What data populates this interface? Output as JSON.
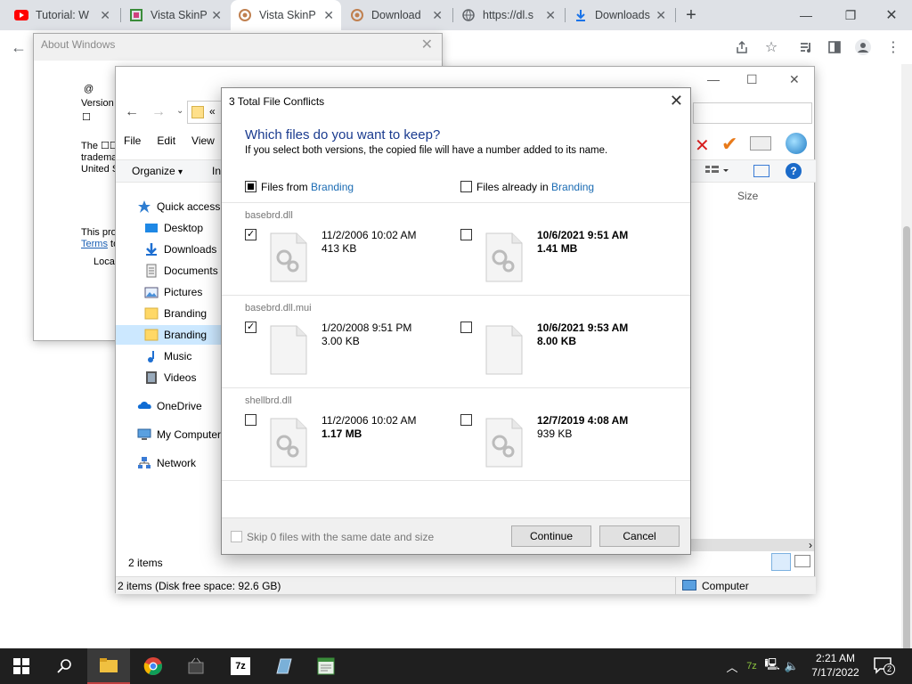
{
  "browser": {
    "tabs": [
      {
        "title": "Tutorial: W",
        "favicon": "youtube-icon"
      },
      {
        "title": "Vista SkinP",
        "favicon": "vistaskin-icon"
      },
      {
        "title": "Vista SkinP",
        "favicon": "vistaskin-icon",
        "active": true
      },
      {
        "title": "Download",
        "favicon": "vistaskin-icon"
      },
      {
        "title": "https://dl.s",
        "favicon": "globe-icon"
      },
      {
        "title": "Downloads",
        "favicon": "download-icon"
      }
    ],
    "new_tab": "+"
  },
  "about_windows": {
    "title": "About Windows",
    "at": "@",
    "version": "Version",
    "box": "☐",
    "line_the": "The ☐☐",
    "line_tradema": "tradema",
    "line_united": "United S",
    "line_this": "This proc",
    "line_terms": "Terms",
    "line_terms_rest": " to",
    "line_local": "Local"
  },
  "explorer": {
    "address_chevron": "«",
    "menu": [
      "File",
      "Edit",
      "View"
    ],
    "organize": "Organize",
    "organize_caret": "▾",
    "in_label": "In",
    "column_size": "Size",
    "nav": [
      {
        "label": "Quick access",
        "icon": "star-icon"
      },
      {
        "label": "Desktop",
        "icon": "desktop-icon"
      },
      {
        "label": "Downloads",
        "icon": "downloads-icon"
      },
      {
        "label": "Documents",
        "icon": "documents-icon"
      },
      {
        "label": "Pictures",
        "icon": "pictures-icon"
      },
      {
        "label": "Branding",
        "icon": "folder-icon"
      },
      {
        "label": "Branding",
        "icon": "folder-icon",
        "selected": true
      },
      {
        "label": "Music",
        "icon": "music-icon"
      },
      {
        "label": "Videos",
        "icon": "videos-icon"
      },
      {
        "label": "OneDrive",
        "icon": "onedrive-icon"
      },
      {
        "label": "My Computer",
        "icon": "computer-icon"
      },
      {
        "label": "Network",
        "icon": "network-icon"
      }
    ],
    "item_count": "2 items",
    "status_left": "2 items (Disk free space: 92.6 GB)",
    "status_right": "Computer"
  },
  "dialog": {
    "title": "3 Total File Conflicts",
    "heading": "Which files do you want to keep?",
    "subtext": "If you select both versions, the copied file will have a number added to its name.",
    "from_prefix": "Files from ",
    "from_folder": "Branding",
    "already_prefix": "Files already in ",
    "already_folder": "Branding",
    "files": [
      {
        "name": "basebrd.dll",
        "left_date": "11/2/2006 10:02 AM",
        "left_size": "413 KB",
        "right_date": "10/6/2021 9:51 AM",
        "right_size": "1.41 MB",
        "left_checked": true,
        "right_checked": false
      },
      {
        "name": "basebrd.dll.mui",
        "left_date": "1/20/2008 9:51 PM",
        "left_size": "3.00 KB",
        "right_date": "10/6/2021 9:53 AM",
        "right_size": "8.00 KB",
        "left_checked": true,
        "right_checked": false
      },
      {
        "name": "shellbrd.dll",
        "left_date": "11/2/2006 10:02 AM",
        "left_size": "1.17 MB",
        "right_date": "12/7/2019 4:08 AM",
        "right_size": "939 KB",
        "left_checked": false,
        "right_checked": false
      }
    ],
    "skip_label": "Skip 0 files with the same date and size",
    "continue_label": "Continue",
    "cancel_label": "Cancel"
  },
  "taskbar": {
    "time": "2:21 AM",
    "date": "7/17/2022",
    "notification_count": "2",
    "lang": "7z"
  }
}
